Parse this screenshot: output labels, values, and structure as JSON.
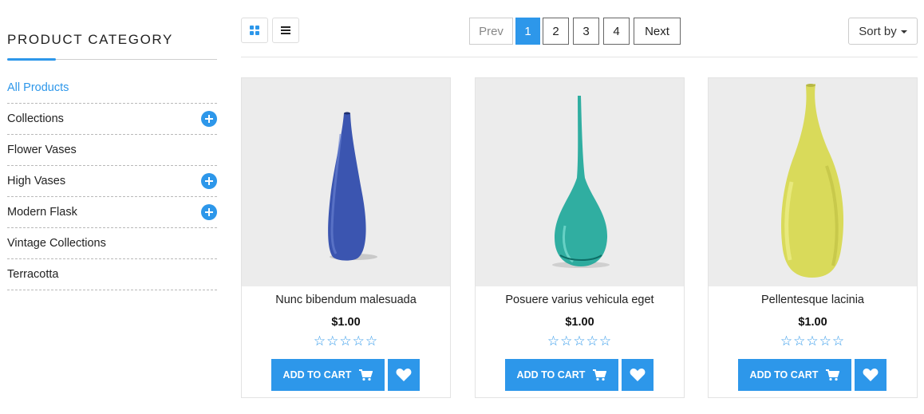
{
  "sidebar": {
    "title": "PRODUCT CATEGORY",
    "categories": [
      {
        "label": "All Products",
        "active": true,
        "expandable": false
      },
      {
        "label": "Collections",
        "active": false,
        "expandable": true
      },
      {
        "label": "Flower Vases",
        "active": false,
        "expandable": false
      },
      {
        "label": "High Vases",
        "active": false,
        "expandable": true
      },
      {
        "label": "Modern Flask",
        "active": false,
        "expandable": true
      },
      {
        "label": "Vintage Collections",
        "active": false,
        "expandable": false
      },
      {
        "label": "Terracotta",
        "active": false,
        "expandable": false
      }
    ]
  },
  "toolbar": {
    "grid_view_icon": "grid-icon",
    "list_view_icon": "list-icon",
    "pagination": {
      "prev_label": "Prev",
      "pages": [
        "1",
        "2",
        "3",
        "4"
      ],
      "current_page": "1",
      "next_label": "Next"
    },
    "sort_label": "Sort by"
  },
  "products": [
    {
      "name": "Nunc bibendum malesuada",
      "price": "$1.00",
      "rating": "☆☆☆☆☆",
      "vase_color": "#3b55b0",
      "cart_label": "ADD TO CART"
    },
    {
      "name": "Posuere varius vehicula eget",
      "price": "$1.00",
      "rating": "☆☆☆☆☆",
      "vase_color": "#1fa89a",
      "cart_label": "ADD TO CART"
    },
    {
      "name": "Pellentesque lacinia",
      "price": "$1.00",
      "rating": "☆☆☆☆☆",
      "vase_color": "#d9da5a",
      "cart_label": "ADD TO CART"
    }
  ],
  "colors": {
    "accent": "#2d97ea",
    "image_bg": "#ececec"
  }
}
